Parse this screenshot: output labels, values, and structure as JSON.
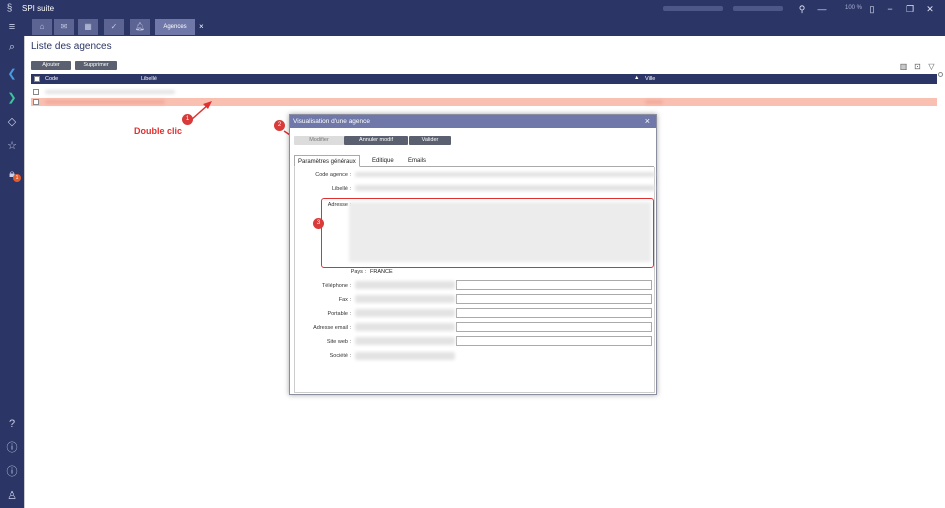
{
  "app": {
    "title": "SPI suite",
    "zoom": "100 %"
  },
  "tabs": {
    "active": "Agences",
    "close": "×"
  },
  "page": {
    "title": "Liste des agences",
    "add": "Ajouter",
    "delete": "Supprimer"
  },
  "grid": {
    "columns": [
      "Code",
      "Libellé",
      "Ville"
    ],
    "sort_indicator": "▲"
  },
  "annotations": {
    "double_click": "Double clic",
    "callout_1": "1",
    "callout_2": "2",
    "callout_3": "3"
  },
  "dialog": {
    "title": "Visualisation d'une agence",
    "close": "×",
    "buttons": {
      "modify": "Modifier",
      "cancel": "Annuler modif",
      "validate": "Valider"
    },
    "tabs": [
      "Paramètres généraux",
      "Editique",
      "Emails"
    ],
    "labels": {
      "code": "Code agence :",
      "libelle": "Libellé :",
      "adresse": "Adresse :",
      "pays": "Pays :",
      "telephone": "Téléphone :",
      "fax": "Fax :",
      "portable": "Portable :",
      "email": "Adresse email :",
      "site": "Site web :",
      "societe": "Société :"
    },
    "values": {
      "pays": "FRANCE"
    }
  },
  "colors": {
    "navy": "#2b3566",
    "selected_row": "#f9c0b2",
    "annotation_red": "#e03030"
  }
}
